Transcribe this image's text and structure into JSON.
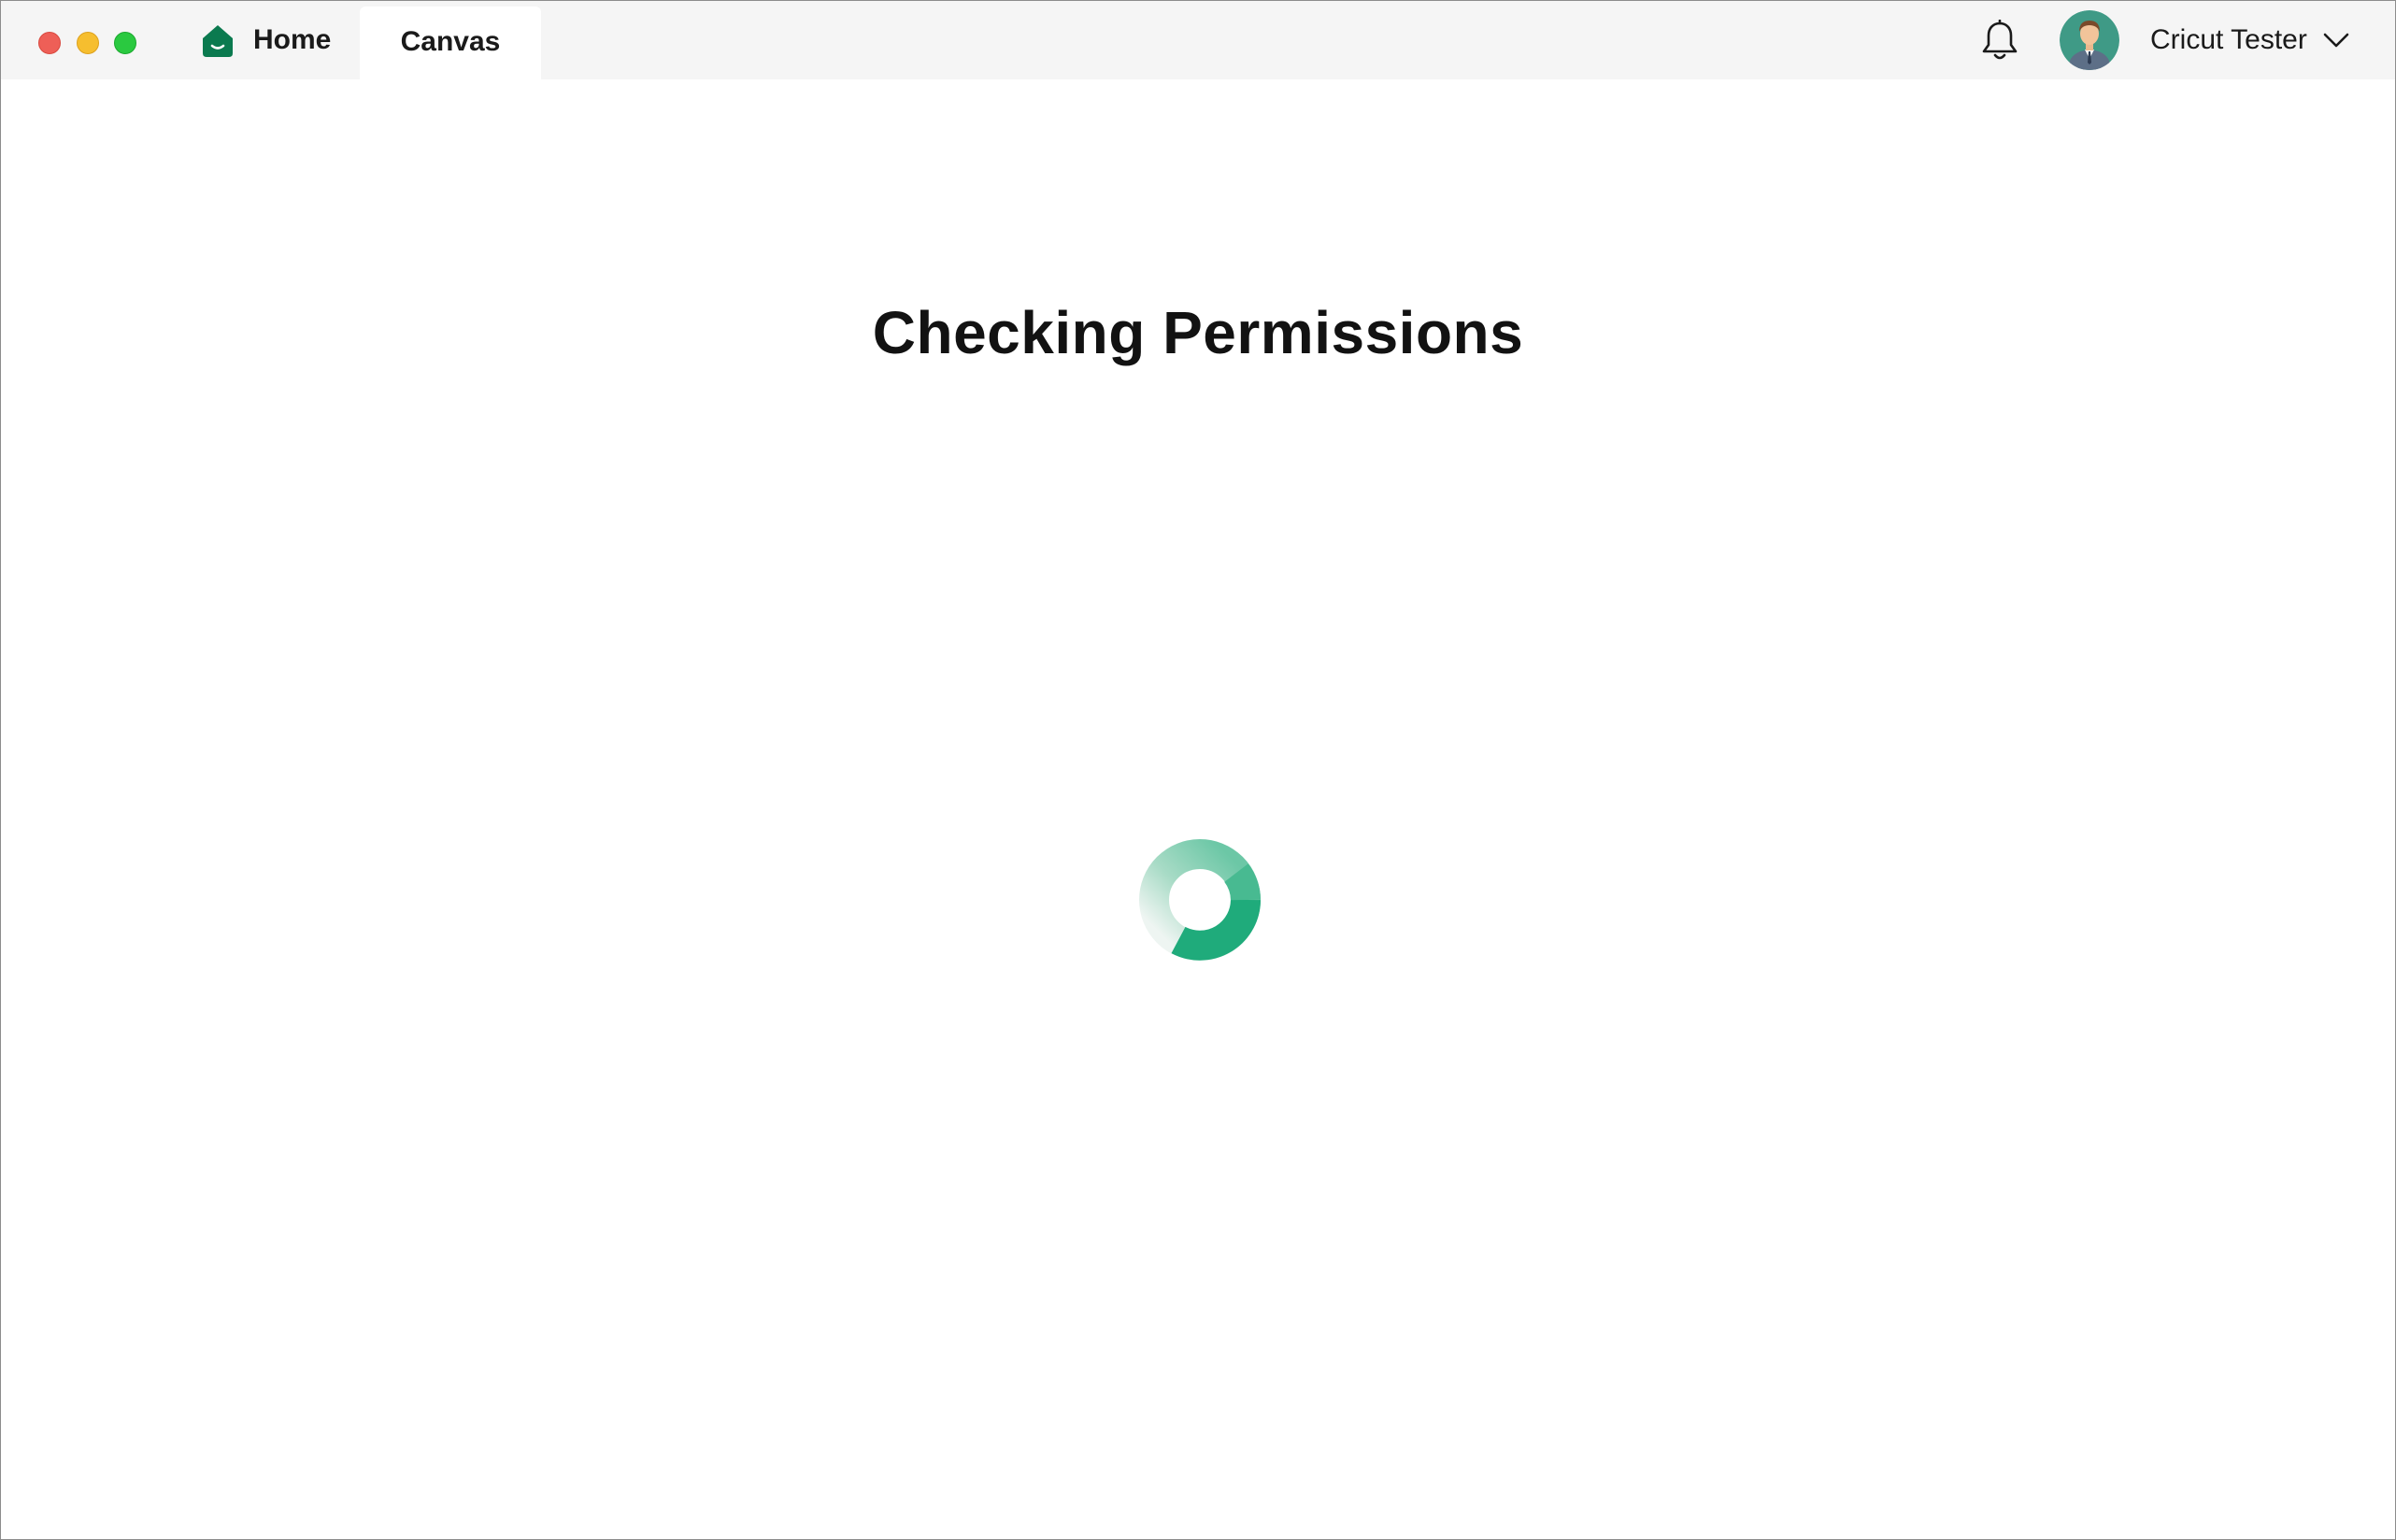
{
  "window": {
    "controls": [
      "close",
      "minimize",
      "maximize"
    ]
  },
  "tabs": [
    {
      "label": "Home",
      "icon": "home-icon",
      "active": false
    },
    {
      "label": "Canvas",
      "active": true
    }
  ],
  "header": {
    "notification_icon": "bell-icon",
    "user": {
      "name": "Cricut Tester",
      "avatar": "user-avatar",
      "dropdown_icon": "chevron-down-icon"
    }
  },
  "main": {
    "title": "Checking Permissions",
    "loading_indicator": "spinner"
  },
  "colors": {
    "brand_green": "#1f9e6e",
    "brand_green_dark": "#0b7a4f",
    "titlebar_bg": "#f5f5f5",
    "close": "#ee5f57",
    "minimize": "#f6be2f",
    "maximize": "#2ac940"
  }
}
